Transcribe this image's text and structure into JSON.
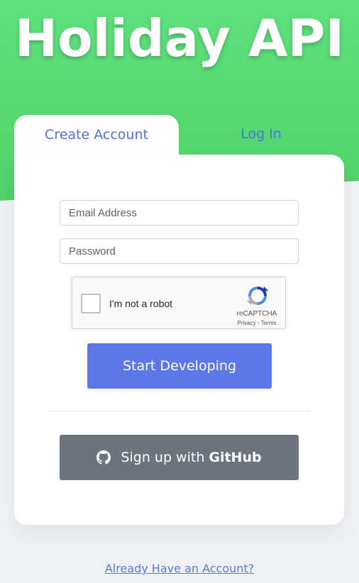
{
  "header": {
    "title": "Holiday API"
  },
  "tabs": [
    {
      "label": "Create Account",
      "active": true
    },
    {
      "label": "Log In",
      "active": false
    }
  ],
  "form": {
    "email_placeholder": "Email Address",
    "email_value": "",
    "password_placeholder": "Password",
    "password_value": ""
  },
  "captcha": {
    "label": "I'm not a robot",
    "brand": "reCAPTCHA",
    "links": "Privacy - Terms",
    "checked": false
  },
  "buttons": {
    "start_label": "Start Developing",
    "github_prefix": "Sign up with",
    "github_bold": "GitHub"
  },
  "footer": {
    "link_label": "Already Have an Account?"
  },
  "icons": {
    "github": "github-icon",
    "recaptcha": "recaptcha-logo-icon"
  },
  "colors": {
    "green": "#55d674",
    "primary": "#5b78e6",
    "secondary": "#6c757d",
    "tab_text": "#4b74e0"
  }
}
